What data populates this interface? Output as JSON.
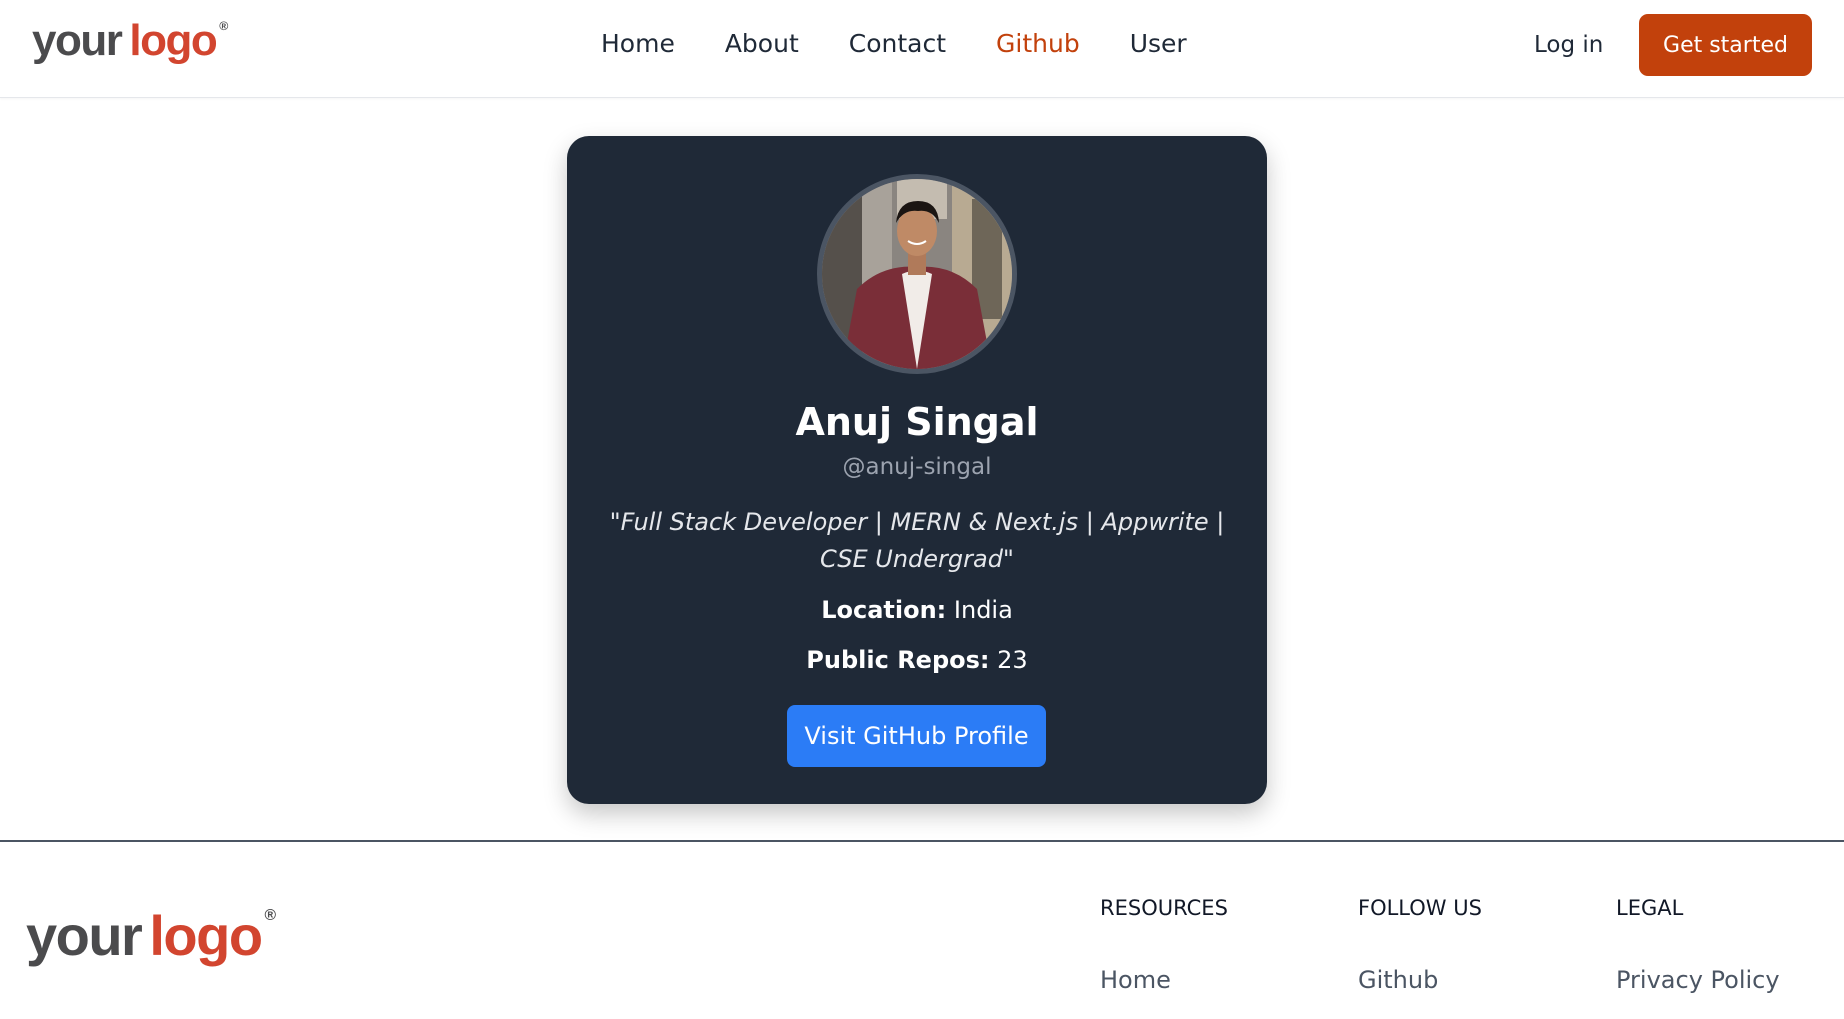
{
  "header": {
    "logo": {
      "word1": "your",
      "word2": "logo",
      "mark": "®"
    },
    "nav": [
      {
        "label": "Home"
      },
      {
        "label": "About"
      },
      {
        "label": "Contact"
      },
      {
        "label": "Github",
        "active": true
      },
      {
        "label": "User"
      }
    ],
    "login_label": "Log in",
    "cta_label": "Get started"
  },
  "profile": {
    "avatar_alt": "profile photo",
    "name": "Anuj Singal",
    "handle": "@anuj-singal",
    "bio": "\"Full Stack Developer | MERN & Next.js | Appwrite | CSE Undergrad\"",
    "location_label": "Location:",
    "location_value": "India",
    "repos_label": "Public Repos:",
    "repos_value": "23",
    "button_label": "Visit GitHub Profile"
  },
  "footer": {
    "logo": {
      "word1": "your",
      "word2": "logo",
      "mark": "®"
    },
    "columns": [
      {
        "title": "RESOURCES",
        "link": "Home"
      },
      {
        "title": "FOLLOW US",
        "link": "Github"
      },
      {
        "title": "LEGAL",
        "link": "Privacy Policy"
      }
    ]
  },
  "colors": {
    "brand_orange": "#c2410c",
    "logo_red": "#d2452f",
    "logo_gray": "#4b4b4d",
    "card_bg": "#1f2937",
    "button_blue": "#2b7cf6"
  }
}
